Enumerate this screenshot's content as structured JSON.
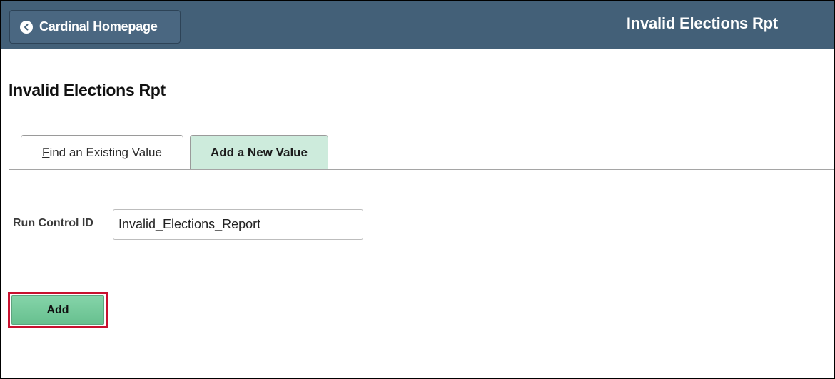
{
  "header": {
    "home_button_label": "Cardinal Homepage",
    "back_icon": "chevron-left-icon",
    "title": "Invalid Elections Rpt",
    "background_color": "#436078"
  },
  "page": {
    "title": "Invalid Elections Rpt"
  },
  "tabs": {
    "find_existing": {
      "accesskey_letter": "F",
      "label_rest": "ind an Existing Value",
      "selected": false
    },
    "add_new": {
      "label": "Add a New Value",
      "selected": true,
      "background_color": "#cdebdc"
    }
  },
  "form": {
    "run_control_label": "Run Control ID",
    "run_control_value": "Invalid_Elections_Report"
  },
  "actions": {
    "add_label": "Add",
    "add_color": "#6cc594",
    "highlight_color": "#c8102e"
  }
}
